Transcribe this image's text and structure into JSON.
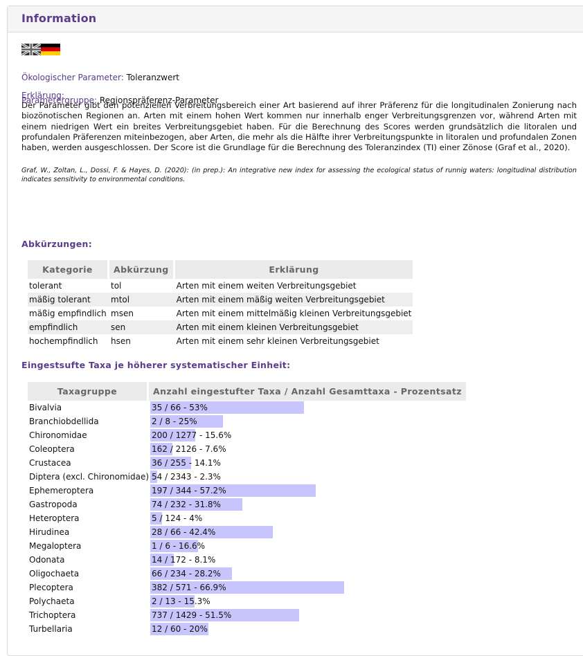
{
  "header": {
    "title": "Information"
  },
  "flags": {
    "en": "uk-flag-icon",
    "de": "german-flag-icon"
  },
  "parameter": {
    "label": "Ökologischer Parameter:",
    "value": "Toleranzwert"
  },
  "group": {
    "label": "Parametergruppe:",
    "value": "Regionspräferenz-Parameter"
  },
  "explanation": {
    "label": "Erklärung:",
    "text": "Der Parameter gibt den potenziellen Verbreitungsbereich einer Art basierend auf ihrer Präferenz für die longitudinalen Zonierung nach biozönotischen Regionen an. Arten mit einem hohen Wert kommen nur innerhalb enger Verbreitungsgrenzen vor, während Arten mit einem niedrigen Wert ein breites Verbreitungsgebiet haben. Für die Berechnung des Scores werden grundsätzlich die litoralen und profundalen Präferenzen miteinbezogen, aber Arten, die mehr als die Hälfte ihrer Verbreitungspunkte in litoralen und profundalen Zonen haben, werden ausgeschlossen. Der Score ist die Grundlage für die Berechnung des Toleranzindex (TI) einer Zönose (Graf et al., 2020).",
    "citation": "Graf, W., Zoltan, L., Dossi, F. & Hayes, D. (2020): (in prep.): An integrative new index for assessing the ecological status of runnig waters: longitudinal distribution indicates sensitivity to environmental conditions."
  },
  "abbreviations": {
    "title": "Abkürzungen:",
    "headers": [
      "Kategorie",
      "Abkürzung",
      "Erklärung"
    ],
    "rows": [
      [
        "tolerant",
        "tol",
        "Arten mit einem weiten Verbreitungsgebiet"
      ],
      [
        "mäßig tolerant",
        "mtol",
        "Arten mit einem mäßig weiten Verbreitungsgebiet"
      ],
      [
        "mäßig empfindlich",
        "msen",
        "Arten mit einem mittelmäßig kleinen Verbreitungsgebiet"
      ],
      [
        "empfindlich",
        "sen",
        "Arten mit einem kleinen Verbreitungsgebiet"
      ],
      [
        "hochempfindlich",
        "hsen",
        "Arten mit einem sehr kleinen Verbreitungsgebiet"
      ]
    ]
  },
  "taxa": {
    "title": "Eingestsufte Taxa je höherer systematischer Einheit:",
    "headers": [
      "Taxagruppe",
      "Anzahl eingestufter Taxa / Anzahl Gesamttaxa - Prozentsatz"
    ],
    "bar_color": "#c8c4fc",
    "rows": [
      {
        "name": "Bivalvia",
        "text": "35 / 66 - 53%",
        "pct": 53
      },
      {
        "name": "Branchiobdellida",
        "text": "2 / 8 - 25%",
        "pct": 25
      },
      {
        "name": "Chironomidae",
        "text": "200 / 1277 - 15.6%",
        "pct": 15.6
      },
      {
        "name": "Coleoptera",
        "text": "162 / 2126 - 7.6%",
        "pct": 7.6
      },
      {
        "name": "Crustacea",
        "text": "36 / 255 - 14.1%",
        "pct": 14.1
      },
      {
        "name": "Diptera (excl. Chironomidae)",
        "text": "54 / 2343 - 2.3%",
        "pct": 2.3
      },
      {
        "name": "Ephemeroptera",
        "text": "197 / 344 - 57.2%",
        "pct": 57.2
      },
      {
        "name": "Gastropoda",
        "text": "74 / 232 - 31.8%",
        "pct": 31.8
      },
      {
        "name": "Heteroptera",
        "text": "5 / 124 - 4%",
        "pct": 4
      },
      {
        "name": "Hirudinea",
        "text": "28 / 66 - 42.4%",
        "pct": 42.4
      },
      {
        "name": "Megaloptera",
        "text": "1 / 6 - 16.6%",
        "pct": 16.6
      },
      {
        "name": "Odonata",
        "text": "14 / 172 - 8.1%",
        "pct": 8.1
      },
      {
        "name": "Oligochaeta",
        "text": "66 / 234 - 28.2%",
        "pct": 28.2
      },
      {
        "name": "Plecoptera",
        "text": "382 / 571 - 66.9%",
        "pct": 66.9
      },
      {
        "name": "Polychaeta",
        "text": "2 / 13 - 15.3%",
        "pct": 15.3
      },
      {
        "name": "Trichoptera",
        "text": "737 / 1429 - 51.5%",
        "pct": 51.5
      },
      {
        "name": "Turbellaria",
        "text": "12 / 60 - 20%",
        "pct": 20
      }
    ]
  }
}
